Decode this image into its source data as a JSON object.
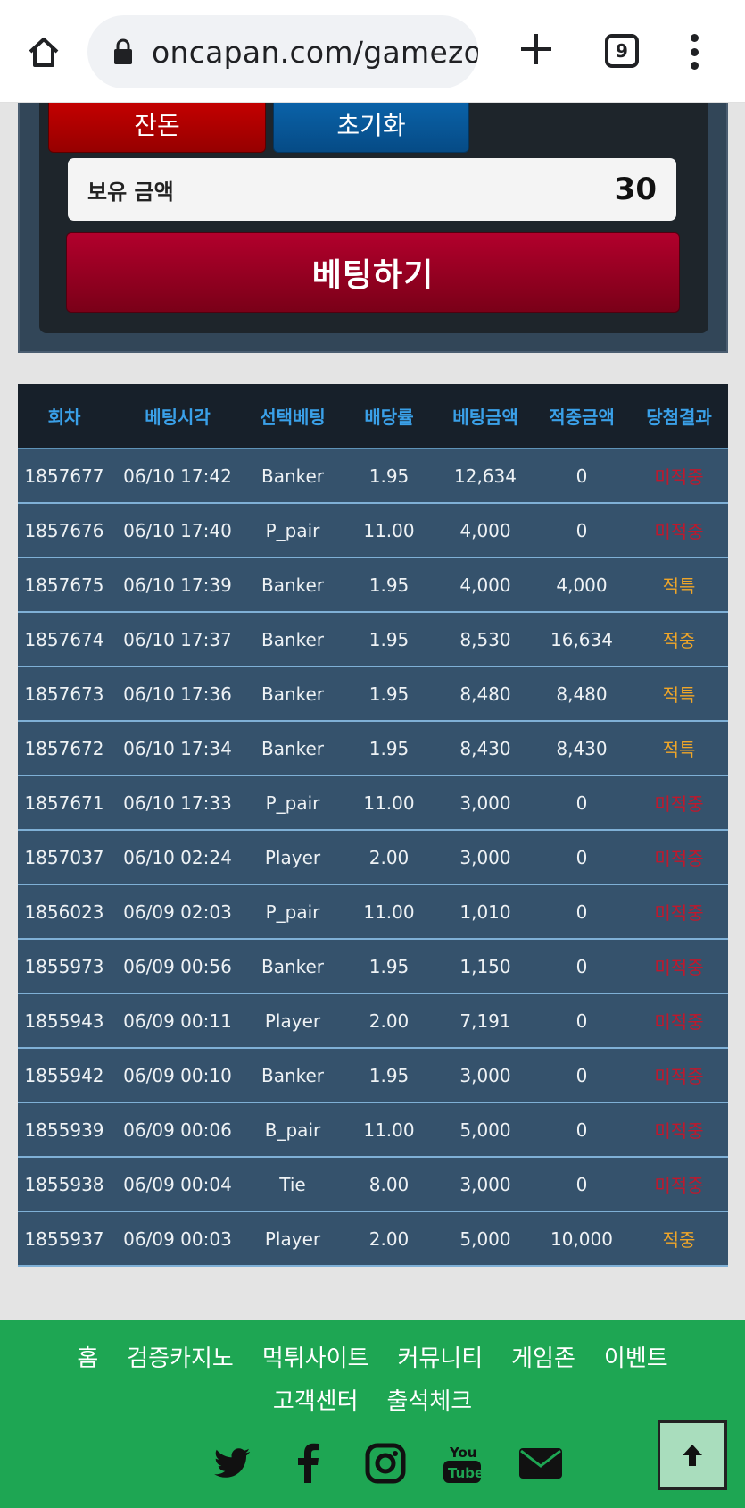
{
  "browser": {
    "url": "oncapan.com/gamezo",
    "tab_count": "9"
  },
  "game": {
    "btn_left": "잔돈",
    "btn_right": "초기화",
    "balance_label": "보유 금액",
    "balance_value": "30",
    "bet_button": "베팅하기"
  },
  "table": {
    "headers": [
      "회차",
      "베팅시각",
      "선택베팅",
      "배당률",
      "베팅금액",
      "적중금액",
      "당첨결과"
    ],
    "rows": [
      {
        "round": "1857677",
        "time": "06/10 17:42",
        "pick": "Banker",
        "odds": "1.95",
        "bet": "12,634",
        "win": "0",
        "result": "미적중",
        "status": "lose"
      },
      {
        "round": "1857676",
        "time": "06/10 17:40",
        "pick": "P_pair",
        "odds": "11.00",
        "bet": "4,000",
        "win": "0",
        "result": "미적중",
        "status": "lose"
      },
      {
        "round": "1857675",
        "time": "06/10 17:39",
        "pick": "Banker",
        "odds": "1.95",
        "bet": "4,000",
        "win": "4,000",
        "result": "적특",
        "status": "win"
      },
      {
        "round": "1857674",
        "time": "06/10 17:37",
        "pick": "Banker",
        "odds": "1.95",
        "bet": "8,530",
        "win": "16,634",
        "result": "적중",
        "status": "win"
      },
      {
        "round": "1857673",
        "time": "06/10 17:36",
        "pick": "Banker",
        "odds": "1.95",
        "bet": "8,480",
        "win": "8,480",
        "result": "적특",
        "status": "win"
      },
      {
        "round": "1857672",
        "time": "06/10 17:34",
        "pick": "Banker",
        "odds": "1.95",
        "bet": "8,430",
        "win": "8,430",
        "result": "적특",
        "status": "win"
      },
      {
        "round": "1857671",
        "time": "06/10 17:33",
        "pick": "P_pair",
        "odds": "11.00",
        "bet": "3,000",
        "win": "0",
        "result": "미적중",
        "status": "lose"
      },
      {
        "round": "1857037",
        "time": "06/10 02:24",
        "pick": "Player",
        "odds": "2.00",
        "bet": "3,000",
        "win": "0",
        "result": "미적중",
        "status": "lose"
      },
      {
        "round": "1856023",
        "time": "06/09 02:03",
        "pick": "P_pair",
        "odds": "11.00",
        "bet": "1,010",
        "win": "0",
        "result": "미적중",
        "status": "lose"
      },
      {
        "round": "1855973",
        "time": "06/09 00:56",
        "pick": "Banker",
        "odds": "1.95",
        "bet": "1,150",
        "win": "0",
        "result": "미적중",
        "status": "lose"
      },
      {
        "round": "1855943",
        "time": "06/09 00:11",
        "pick": "Player",
        "odds": "2.00",
        "bet": "7,191",
        "win": "0",
        "result": "미적중",
        "status": "lose"
      },
      {
        "round": "1855942",
        "time": "06/09 00:10",
        "pick": "Banker",
        "odds": "1.95",
        "bet": "3,000",
        "win": "0",
        "result": "미적중",
        "status": "lose"
      },
      {
        "round": "1855939",
        "time": "06/09 00:06",
        "pick": "B_pair",
        "odds": "11.00",
        "bet": "5,000",
        "win": "0",
        "result": "미적중",
        "status": "lose"
      },
      {
        "round": "1855938",
        "time": "06/09 00:04",
        "pick": "Tie",
        "odds": "8.00",
        "bet": "3,000",
        "win": "0",
        "result": "미적중",
        "status": "lose"
      },
      {
        "round": "1855937",
        "time": "06/09 00:03",
        "pick": "Player",
        "odds": "2.00",
        "bet": "5,000",
        "win": "10,000",
        "result": "적중",
        "status": "win"
      }
    ]
  },
  "footer": {
    "nav_row1": [
      "홈",
      "검증카지노",
      "먹튀사이트",
      "커뮤니티",
      "게임존",
      "이벤트"
    ],
    "nav_row2": [
      "고객센터",
      "출석체크"
    ],
    "social": [
      "twitter-icon",
      "facebook-icon",
      "instagram-icon",
      "youtube-icon",
      "mail-icon"
    ]
  },
  "colors": {
    "footer_bg": "#1ea653",
    "header_text": "#3aa0e8",
    "row_bg": "#35526c",
    "lose": "#c0182c",
    "win": "#f0a628"
  }
}
